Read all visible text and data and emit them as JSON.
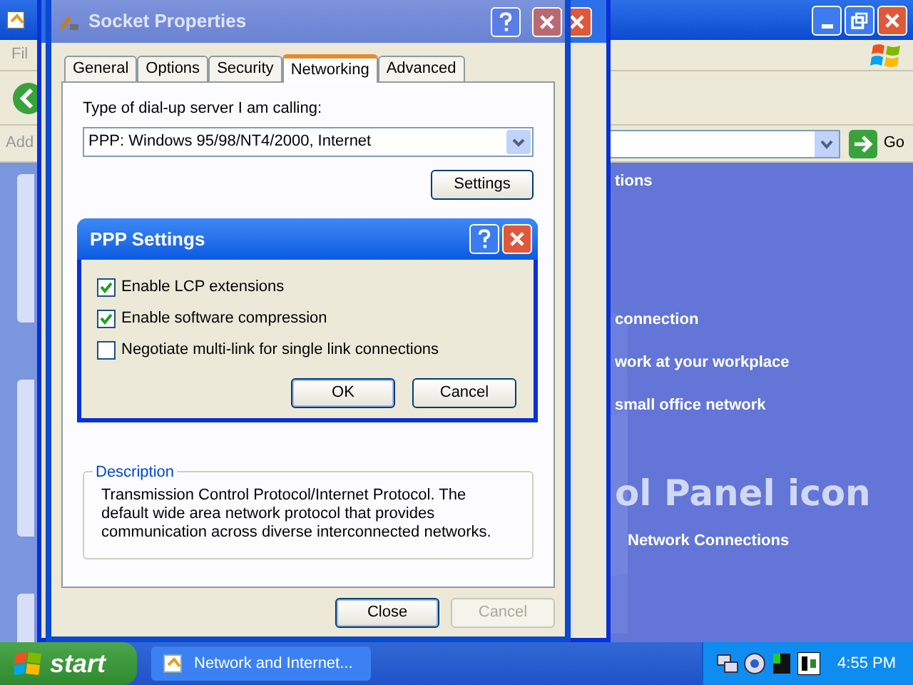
{
  "background_window": {
    "menu_item": "Fil",
    "address_label": "Add",
    "go_button": "Go",
    "tasks": [
      "tions",
      "connection",
      "work at your workplace",
      "small office network"
    ],
    "heading": "ol Panel icon",
    "link": "Network Connections"
  },
  "socket_dialog": {
    "title": "Socket Properties",
    "tabs": [
      {
        "label": "General",
        "selected": false
      },
      {
        "label": "Options",
        "selected": false
      },
      {
        "label": "Security",
        "selected": false
      },
      {
        "label": "Networking",
        "selected": true
      },
      {
        "label": "Advanced",
        "selected": false
      }
    ],
    "server_type_label": "Type of dial-up server I am calling:",
    "server_type_value": "PPP: Windows 95/98/NT4/2000, Internet",
    "settings_button": "Settings",
    "description_label": "Description",
    "description_text": "Transmission Control Protocol/Internet Protocol. The default wide area network protocol that provides communication across diverse interconnected networks.",
    "buttons": [
      {
        "label": "Close",
        "disabled": false
      },
      {
        "label": "Cancel",
        "disabled": true
      }
    ]
  },
  "ppp_dialog": {
    "title": "PPP Settings",
    "options": [
      {
        "label": "Enable LCP extensions",
        "checked": true
      },
      {
        "label": "Enable software compression",
        "checked": true
      },
      {
        "label": "Negotiate multi-link for single link connections",
        "checked": false
      }
    ],
    "buttons": [
      {
        "label": "OK",
        "disabled": false
      },
      {
        "label": "Cancel",
        "disabled": false
      }
    ]
  },
  "taskbar": {
    "start": "start",
    "task": "Network and Internet...",
    "clock": "4:55 PM"
  }
}
